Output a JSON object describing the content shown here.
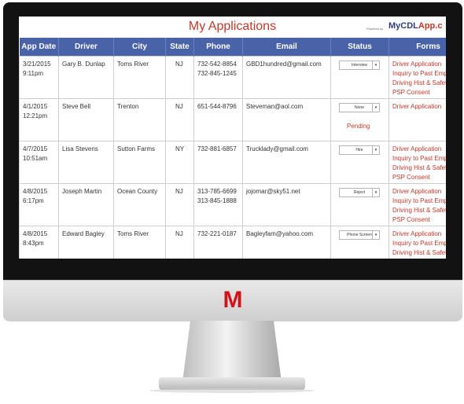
{
  "chin_logo": "M",
  "header": {
    "title": "My Applications",
    "powered_by": "Powered by",
    "brand_main": "MyCDL",
    "brand_accent": "App.c"
  },
  "columns": [
    "App Date",
    "Driver",
    "City",
    "State",
    "Phone",
    "Email",
    "Status",
    "Forms"
  ],
  "rows": [
    {
      "date": "3/21/2015",
      "time": "9:11pm",
      "driver": "Gary B. Dunlap",
      "city": "Toms River",
      "state": "NJ",
      "phone1": "732-542-8854",
      "phone2": "732-845-1245",
      "email": "GBD1hundred@gmail.com",
      "status": "Interview",
      "status_note": "",
      "forms": [
        "Driver Application",
        "Inquiry to Past Emp",
        "Driving Hist & Safet",
        "PSP Consent"
      ]
    },
    {
      "date": "4/1/2015",
      "time": "12:21pm",
      "driver": "Steve Bell",
      "city": "Trenton",
      "state": "NJ",
      "phone1": "651-544-8796",
      "phone2": "",
      "email": "Steveman@aol.com",
      "status": "None",
      "status_note": "Pending",
      "forms": [
        "Driver Application",
        "",
        "",
        ""
      ]
    },
    {
      "date": "4/7/2015",
      "time": "10:51am",
      "driver": "Lisa Stevens",
      "city": "Sutton Farms",
      "state": "NY",
      "phone1": "732-881-6857",
      "phone2": "",
      "email": "Trucklady@gmail.com",
      "status": "Hire",
      "status_note": "",
      "forms": [
        "Driver Application",
        "Inquiry to Past Emp",
        "Driving Hist & Safet",
        "PSP Consent"
      ]
    },
    {
      "date": "4/8/2015",
      "time": "6:17pm",
      "driver": "Joseph Martin",
      "city": "Ocean County",
      "state": "NJ",
      "phone1": "313-785-6699",
      "phone2": "313-845-1888",
      "email": "jojomar@sky51.net",
      "status": "Reject",
      "status_note": "",
      "forms": [
        "Driver Application",
        "Inquiry to Past Emp",
        "Driving Hist & Safet",
        "PSP Consent"
      ]
    },
    {
      "date": "4/8/2015",
      "time": "8:43pm",
      "driver": "Edward Bagley",
      "city": "Toms River",
      "state": "NJ",
      "phone1": "732-221-0187",
      "phone2": "",
      "email": "Bagleyfam@yahoo.com",
      "status": "Phone Screen",
      "status_note": "",
      "forms": [
        "Driver Application",
        "Inquiry to Past Emp",
        "Driving Hist & Safet",
        ""
      ]
    }
  ],
  "colors": {
    "header_bg": "#4a62a8",
    "accent": "#c0392b",
    "brand": "#2f3f7a"
  }
}
